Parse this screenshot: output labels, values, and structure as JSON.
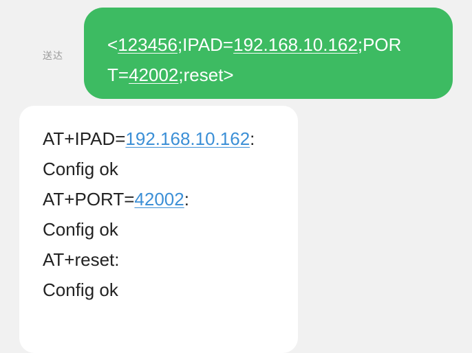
{
  "status_label": "送达",
  "outgoing": {
    "open": "<",
    "password": "123456",
    "sep1": ";IPAD=",
    "ip": "192.168.10.162",
    "sep2": ";POR",
    "sep3": "T=",
    "port": "42002",
    "tail": ";reset>"
  },
  "incoming": {
    "line1_prefix": "AT+IPAD=",
    "line1_ip": "192.168.10.162",
    "line1_suffix": ":",
    "line2": "Config ok",
    "line3_prefix": "AT+PORT=",
    "line3_port": "42002",
    "line3_suffix": ":",
    "line4": "Config ok",
    "line5": "AT+reset:",
    "line6": "Config ok"
  },
  "colors": {
    "outgoing_bubble": "#3dbb62",
    "link": "#3b8fd6",
    "background": "#f1f1f1"
  }
}
